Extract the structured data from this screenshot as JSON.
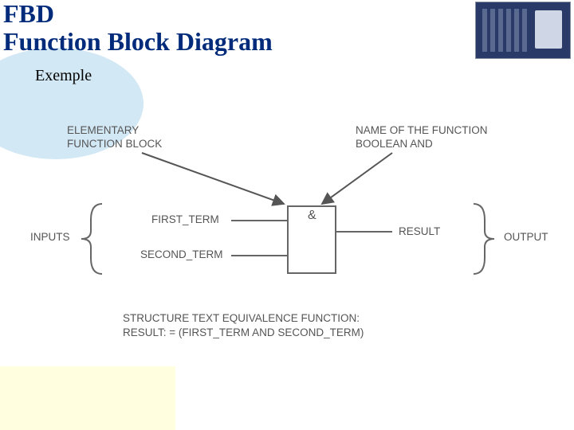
{
  "title": {
    "line1": "FBD",
    "line2": "Function Block Diagram"
  },
  "subtitle": "Exemple",
  "labels": {
    "elem_fb": "ELEMENTARY\nFUNCTION BLOCK",
    "name_fn": "NAME OF THE FUNCTION\nBOOLEAN AND",
    "first_term": "FIRST_TERM",
    "second_term": "SECOND_TERM",
    "inputs": "INPUTS",
    "result": "RESULT",
    "output": "OUTPUT",
    "st_line1": "STRUCTURE TEXT EQUIVALENCE FUNCTION:",
    "st_line2": "RESULT: = (FIRST_TERM AND SECOND_TERM)"
  },
  "block": {
    "symbol": "&"
  },
  "diagram_meta": {
    "type": "function-block",
    "function": "AND",
    "inputs": [
      "FIRST_TERM",
      "SECOND_TERM"
    ],
    "outputs": [
      "RESULT"
    ],
    "st_equivalent": "RESULT := (FIRST_TERM AND SECOND_TERM)"
  }
}
